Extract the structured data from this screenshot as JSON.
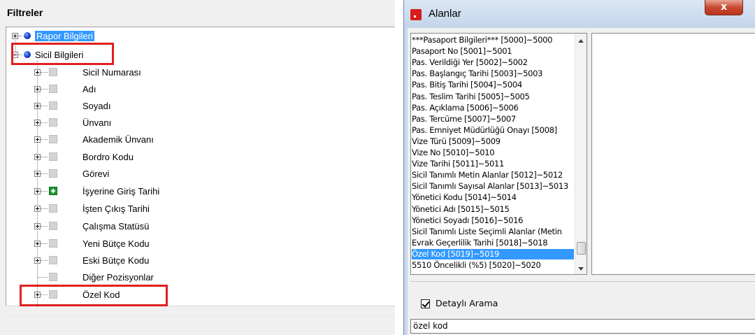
{
  "filters_panel": {
    "title": "Filtreler",
    "root_items": [
      {
        "label": "Rapor Bilgileri",
        "expander": "plus",
        "selected": true
      },
      {
        "label": "Sicil Bilgileri",
        "expander": "minus",
        "selected": false
      }
    ],
    "children": [
      {
        "label": "Sicil Numarası",
        "icon": "gray-box-icon"
      },
      {
        "label": "Adı",
        "icon": "gray-box-icon"
      },
      {
        "label": "Soyadı",
        "icon": "gray-box-icon"
      },
      {
        "label": "Ünvanı",
        "icon": "gray-box-icon"
      },
      {
        "label": "Akademik Ünvanı",
        "icon": "gray-box-icon"
      },
      {
        "label": "Bordro Kodu",
        "icon": "gray-box-icon"
      },
      {
        "label": "Görevi",
        "icon": "gray-box-icon"
      },
      {
        "label": "İşyerine Giriş Tarihi",
        "icon": "green-plus-icon"
      },
      {
        "label": "İşten Çıkış Tarihi",
        "icon": "gray-box-icon"
      },
      {
        "label": "Çalışma Statüsü",
        "icon": "gray-box-icon"
      },
      {
        "label": "Yeni Bütçe Kodu",
        "icon": "gray-box-icon"
      },
      {
        "label": "Eski Bütçe Kodu",
        "icon": "gray-box-icon"
      },
      {
        "label": "Diğer Pozisyonlar",
        "icon": "gray-box-icon"
      },
      {
        "label": "Özel Kod",
        "icon": "gray-box-icon"
      }
    ]
  },
  "alanlar_dialog": {
    "title": "Alanlar",
    "close_label": "x",
    "fields": [
      "***Pasaport Bilgileri*** [5000]~5000",
      "Pasaport No [5001]~5001",
      "Pas. Verildiği Yer [5002]~5002",
      "Pas. Başlangıç Tarihi [5003]~5003",
      "Pas. Bitiş Tarihi [5004]~5004",
      "Pas. Teslim Tarihi [5005]~5005",
      "Pas. Açıklama [5006]~5006",
      "Pas. Tercüme [5007]~5007",
      "Pas. Emniyet Müdürlüğü Onayı [5008]",
      "Vize Türü [5009]~5009",
      "Vize No [5010]~5010",
      "Vize Tarihi [5011]~5011",
      "Sicil Tanımlı Metin Alanlar [5012]~5012",
      "Sicil Tanımlı Sayısal Alanlar [5013]~5013",
      "Yönetici Kodu [5014]~5014",
      "Yönetici Adı [5015]~5015",
      "Yönetici Soyadı [5016]~5016",
      "Sicil Tanımlı Liste Seçimli Alanlar (Metin",
      "Evrak Geçerlilik Tarihi [5018]~5018",
      "Özel Kod [5019]~5019",
      "5510 Öncelikli (%5) [5020]~5020"
    ],
    "selected_index": 19,
    "detailed_search_label": "Detaylı Arama",
    "detailed_search_checked": true,
    "search_value": "özel kod"
  }
}
